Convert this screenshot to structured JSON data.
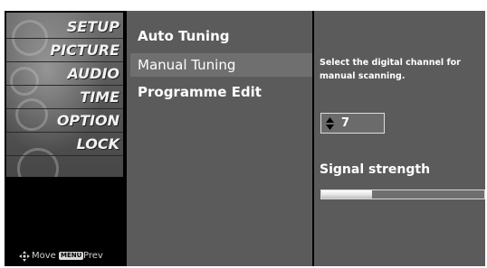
{
  "menu": {
    "items": [
      {
        "label": "SETUP"
      },
      {
        "label": "PICTURE"
      },
      {
        "label": "AUDIO"
      },
      {
        "label": "TIME"
      },
      {
        "label": "OPTION"
      },
      {
        "label": "LOCK"
      }
    ],
    "art_caption": "OPTION"
  },
  "hints": {
    "move_label": "Move",
    "menu_key": "MENU",
    "prev_label": "Prev"
  },
  "submenu": {
    "items": [
      {
        "label": "Auto Tuning"
      },
      {
        "label": "Manual Tuning"
      },
      {
        "label": "Programme Edit"
      }
    ],
    "selected": "Manual Tuning"
  },
  "detail": {
    "description": "Select the digital channel for manual scanning.",
    "channel_value": "7",
    "signal_label": "Signal strength",
    "signal_level": 0.31
  },
  "colors": {
    "panel": "#5b5b5b",
    "selected_row": "#6f6f6f",
    "text": "#ffffff"
  }
}
